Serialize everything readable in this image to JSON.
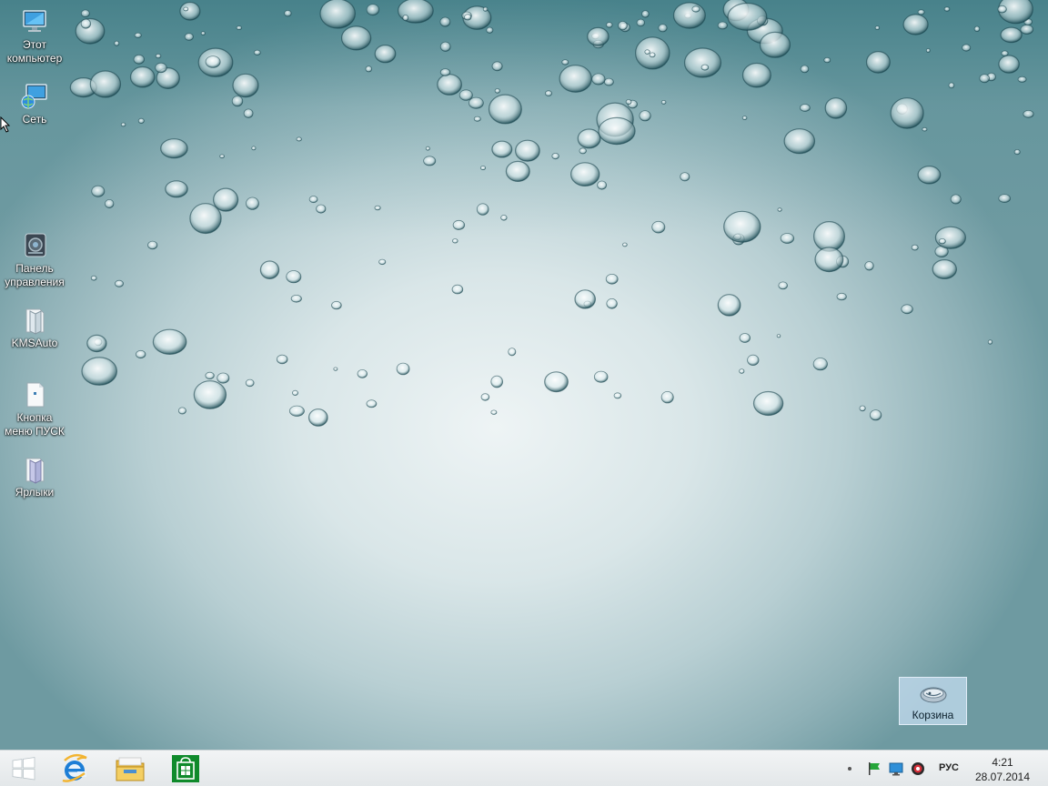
{
  "desktop": {
    "icons": [
      {
        "name": "this-pc",
        "label_line1": "Этот",
        "label_line2": "компьютер"
      },
      {
        "name": "network",
        "label_line1": "Сеть",
        "label_line2": ""
      },
      {
        "name": "control-panel",
        "label_line1": "Панель",
        "label_line2": "управления"
      },
      {
        "name": "kmsauto",
        "label_line1": "KMSAuto",
        "label_line2": ""
      },
      {
        "name": "start-menu-button",
        "label_line1": "Кнопка",
        "label_line2": "меню ПУСК"
      },
      {
        "name": "shortcuts",
        "label_line1": "Ярлыки",
        "label_line2": ""
      }
    ],
    "recycle_bin": {
      "label": "Корзина"
    }
  },
  "taskbar": {
    "pinned": [
      {
        "name": "start",
        "icon": "windows-logo-icon"
      },
      {
        "name": "internet-explorer",
        "icon": "internet-explorer-icon"
      },
      {
        "name": "file-explorer",
        "icon": "folder-icon"
      },
      {
        "name": "store",
        "icon": "store-icon"
      }
    ],
    "tray": {
      "language": "РУС",
      "time": "4:21",
      "date": "28.07.2014"
    }
  },
  "colors": {
    "taskbar_bg": "#eceff0",
    "store_green": "#0f8a2b",
    "ie_blue": "#1d7ed6",
    "folder_yellow": "#e8b841"
  }
}
